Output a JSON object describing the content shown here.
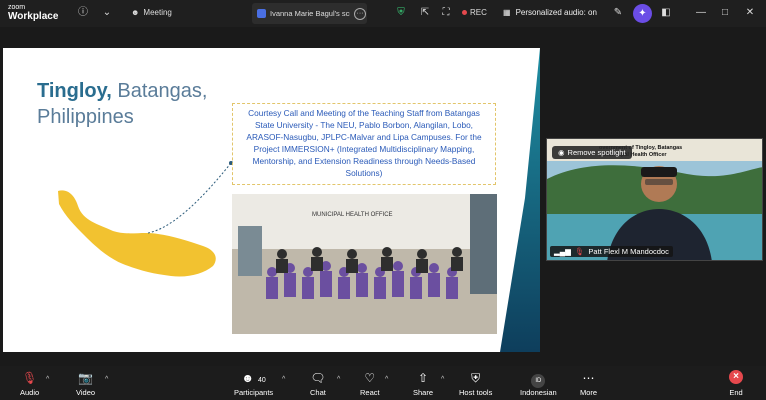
{
  "app": {
    "logo_line1": "zoom",
    "logo_line2": "Workplace"
  },
  "topbar": {
    "meeting_label": "Meeting",
    "share_tab_label": "Ivanna Marie Bagul's scr",
    "rec_label": "REC",
    "personalized_audio": "Personalized audio: on"
  },
  "slide": {
    "title_bold": "Tingloy,",
    "title_rest": "Batangas,",
    "title_line2": "Philippines",
    "callout": "Courtesy Call and Meeting of the Teaching Staff from Batangas State University - The NEU, Pablo Borbon, Alangilan, Lobo, ARASOF-Nasugbu, JPLPC-Malvar and Lipa Campuses. For the Project IMMERSION+ (Integrated Multidisciplinary Mapping, Mentorship, and Extension Readiness through Needs-Based Solutions)",
    "photo_sign": "MUNICIPAL HEALTH OFFICE"
  },
  "video": {
    "remove_spotlight": "Remove spotlight",
    "participant_name": "Patt Flexl M Mandocdoc",
    "banner_line1": "overnment of Tingloy, Batangas",
    "banner_line2": "e Municipal Health Officer"
  },
  "toolbar": {
    "audio": "Audio",
    "video": "Video",
    "participants": "Participants",
    "participants_count": "40",
    "chat": "Chat",
    "react": "React",
    "share": "Share",
    "host_tools": "Host tools",
    "language": "Indonesian",
    "language_badge": "ID",
    "more": "More",
    "end": "End"
  },
  "colors": {
    "accent": "#6b4de6",
    "end": "#e5484d",
    "slide_title": "#2a6d8f",
    "callout_text": "#2a5ab8",
    "island": "#f2c230"
  }
}
